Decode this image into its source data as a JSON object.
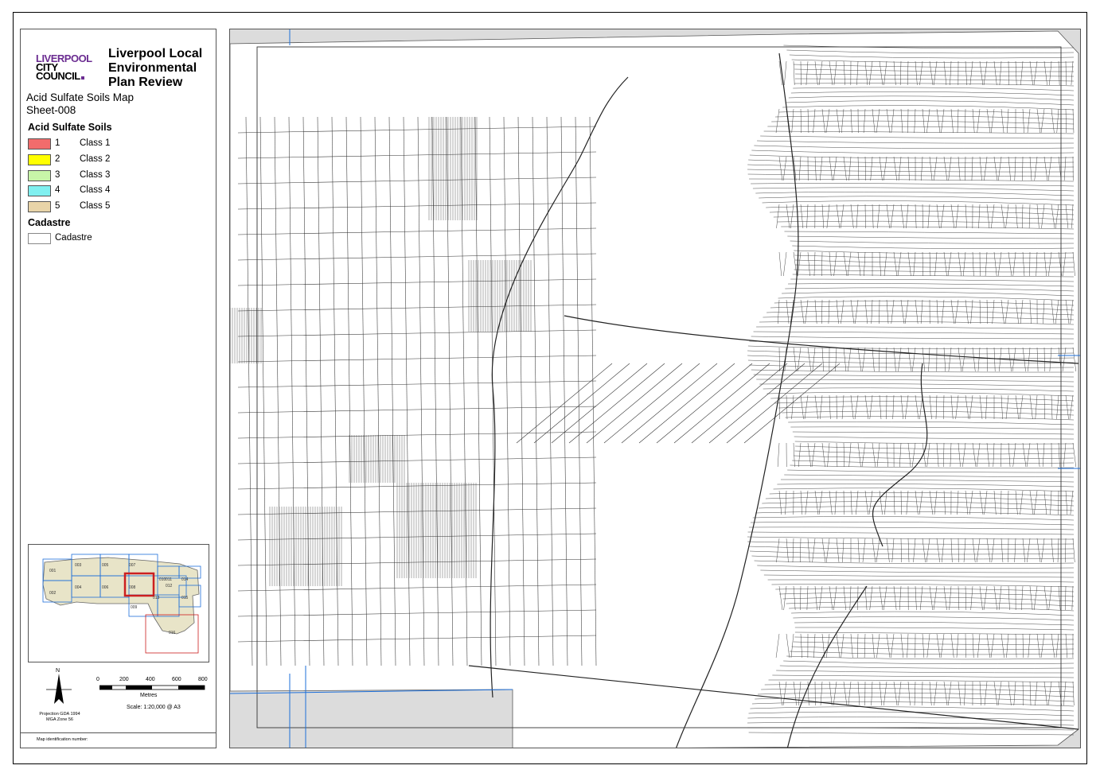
{
  "header": {
    "logo": {
      "line1": "LIVERPOOL",
      "line2": "CITY",
      "line3": "COUNCIL"
    },
    "title": "Liverpool Local Environmental Plan Review",
    "map_name": "Acid Sulfate Soils Map",
    "sheet": "Sheet-008"
  },
  "legend": {
    "acid_title": "Acid Sulfate Soils",
    "classes": [
      {
        "code": "1",
        "label": "Class 1",
        "color": "#f26c6c"
      },
      {
        "code": "2",
        "label": "Class 2",
        "color": "#ffff00"
      },
      {
        "code": "3",
        "label": "Class 3",
        "color": "#c8f5a8"
      },
      {
        "code": "4",
        "label": "Class 4",
        "color": "#80f0f0"
      },
      {
        "code": "5",
        "label": "Class 5",
        "color": "#e8d4a8"
      }
    ],
    "cadastre_title": "Cadastre",
    "cadastre_label": "Cadastre"
  },
  "index_map": {
    "sheets": [
      "001",
      "002",
      "003",
      "004",
      "005",
      "006",
      "007",
      "008",
      "009",
      "011",
      "012",
      "013",
      "014",
      "015",
      "016",
      "010"
    ],
    "selected": "008"
  },
  "north_label": "N",
  "scale": {
    "ticks": [
      "0",
      "200",
      "400",
      "600",
      "800"
    ],
    "unit": "Metres",
    "text": "Scale: 1:20,000 @ A3"
  },
  "projection": {
    "line1": "Projection GDA 1994",
    "line2": "MGA Zone 56"
  },
  "map_id_label": "Map identification number:",
  "colors": {
    "map_bg": "#dcdcdc",
    "parcel_fill": "#ffffff",
    "parcel_line": "#333333",
    "grid_line": "#1e6fd9",
    "index_fill": "#e8e4c8",
    "index_selected": "#cc1f1f"
  }
}
